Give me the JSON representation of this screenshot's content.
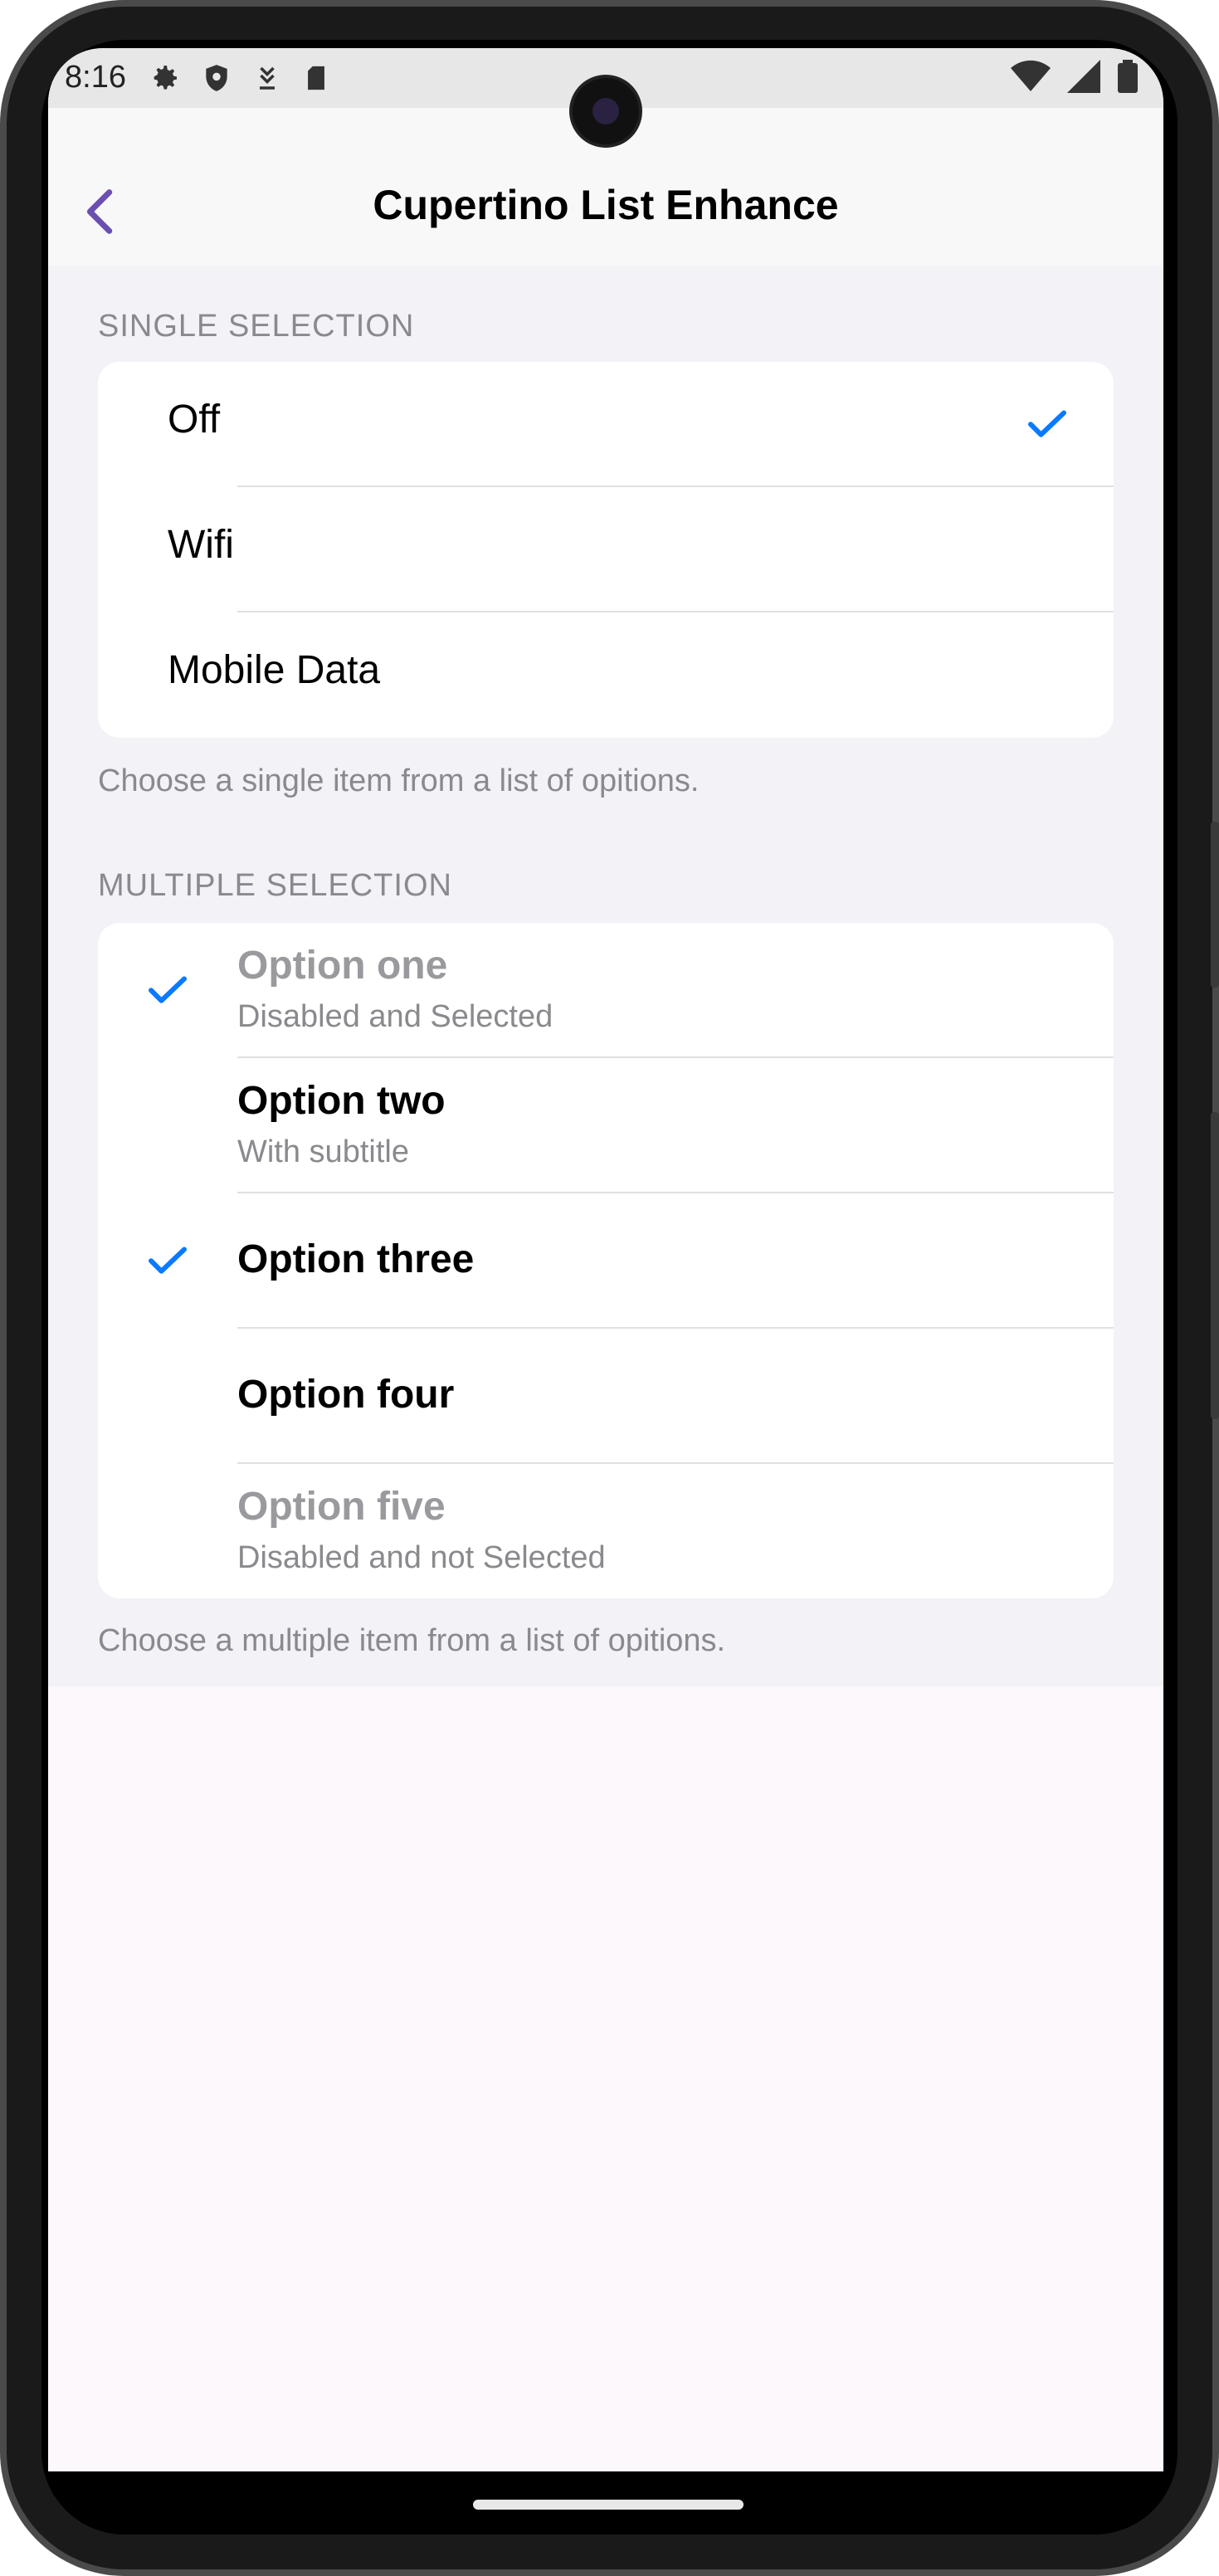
{
  "status_bar": {
    "time": "8:16",
    "left_icons": [
      "gear-icon",
      "shield-icon",
      "download-icon",
      "sd-card-icon"
    ],
    "right_icons": [
      "wifi-icon",
      "signal-icon",
      "battery-icon"
    ]
  },
  "nav": {
    "title": "Cupertino List Enhance",
    "back_icon": "chevron-left-icon"
  },
  "single_section": {
    "header": "SINGLE SELECTION",
    "items": [
      {
        "label": "Off",
        "selected": true
      },
      {
        "label": "Wifi",
        "selected": false
      },
      {
        "label": "Mobile Data",
        "selected": false
      }
    ],
    "footer": "Choose a single item from  a list of opitions."
  },
  "multiple_section": {
    "header": "MULTIPLE SELECTION",
    "items": [
      {
        "title": "Option one",
        "subtitle": "Disabled and Selected",
        "selected": true,
        "disabled": true
      },
      {
        "title": "Option two",
        "subtitle": "With subtitle",
        "selected": false,
        "disabled": false
      },
      {
        "title": "Option three",
        "subtitle": "",
        "selected": true,
        "disabled": false
      },
      {
        "title": "Option four",
        "subtitle": "",
        "selected": false,
        "disabled": false
      },
      {
        "title": "Option five",
        "subtitle": "Disabled and not Selected",
        "selected": false,
        "disabled": true
      }
    ],
    "footer": "Choose a multiple item from  a list of opitions."
  },
  "colors": {
    "accent": "#0a7aff",
    "back_chevron": "#6a4fb0",
    "grouped_background": "#f2f2f7",
    "secondary_text": "#8a8a8e"
  }
}
